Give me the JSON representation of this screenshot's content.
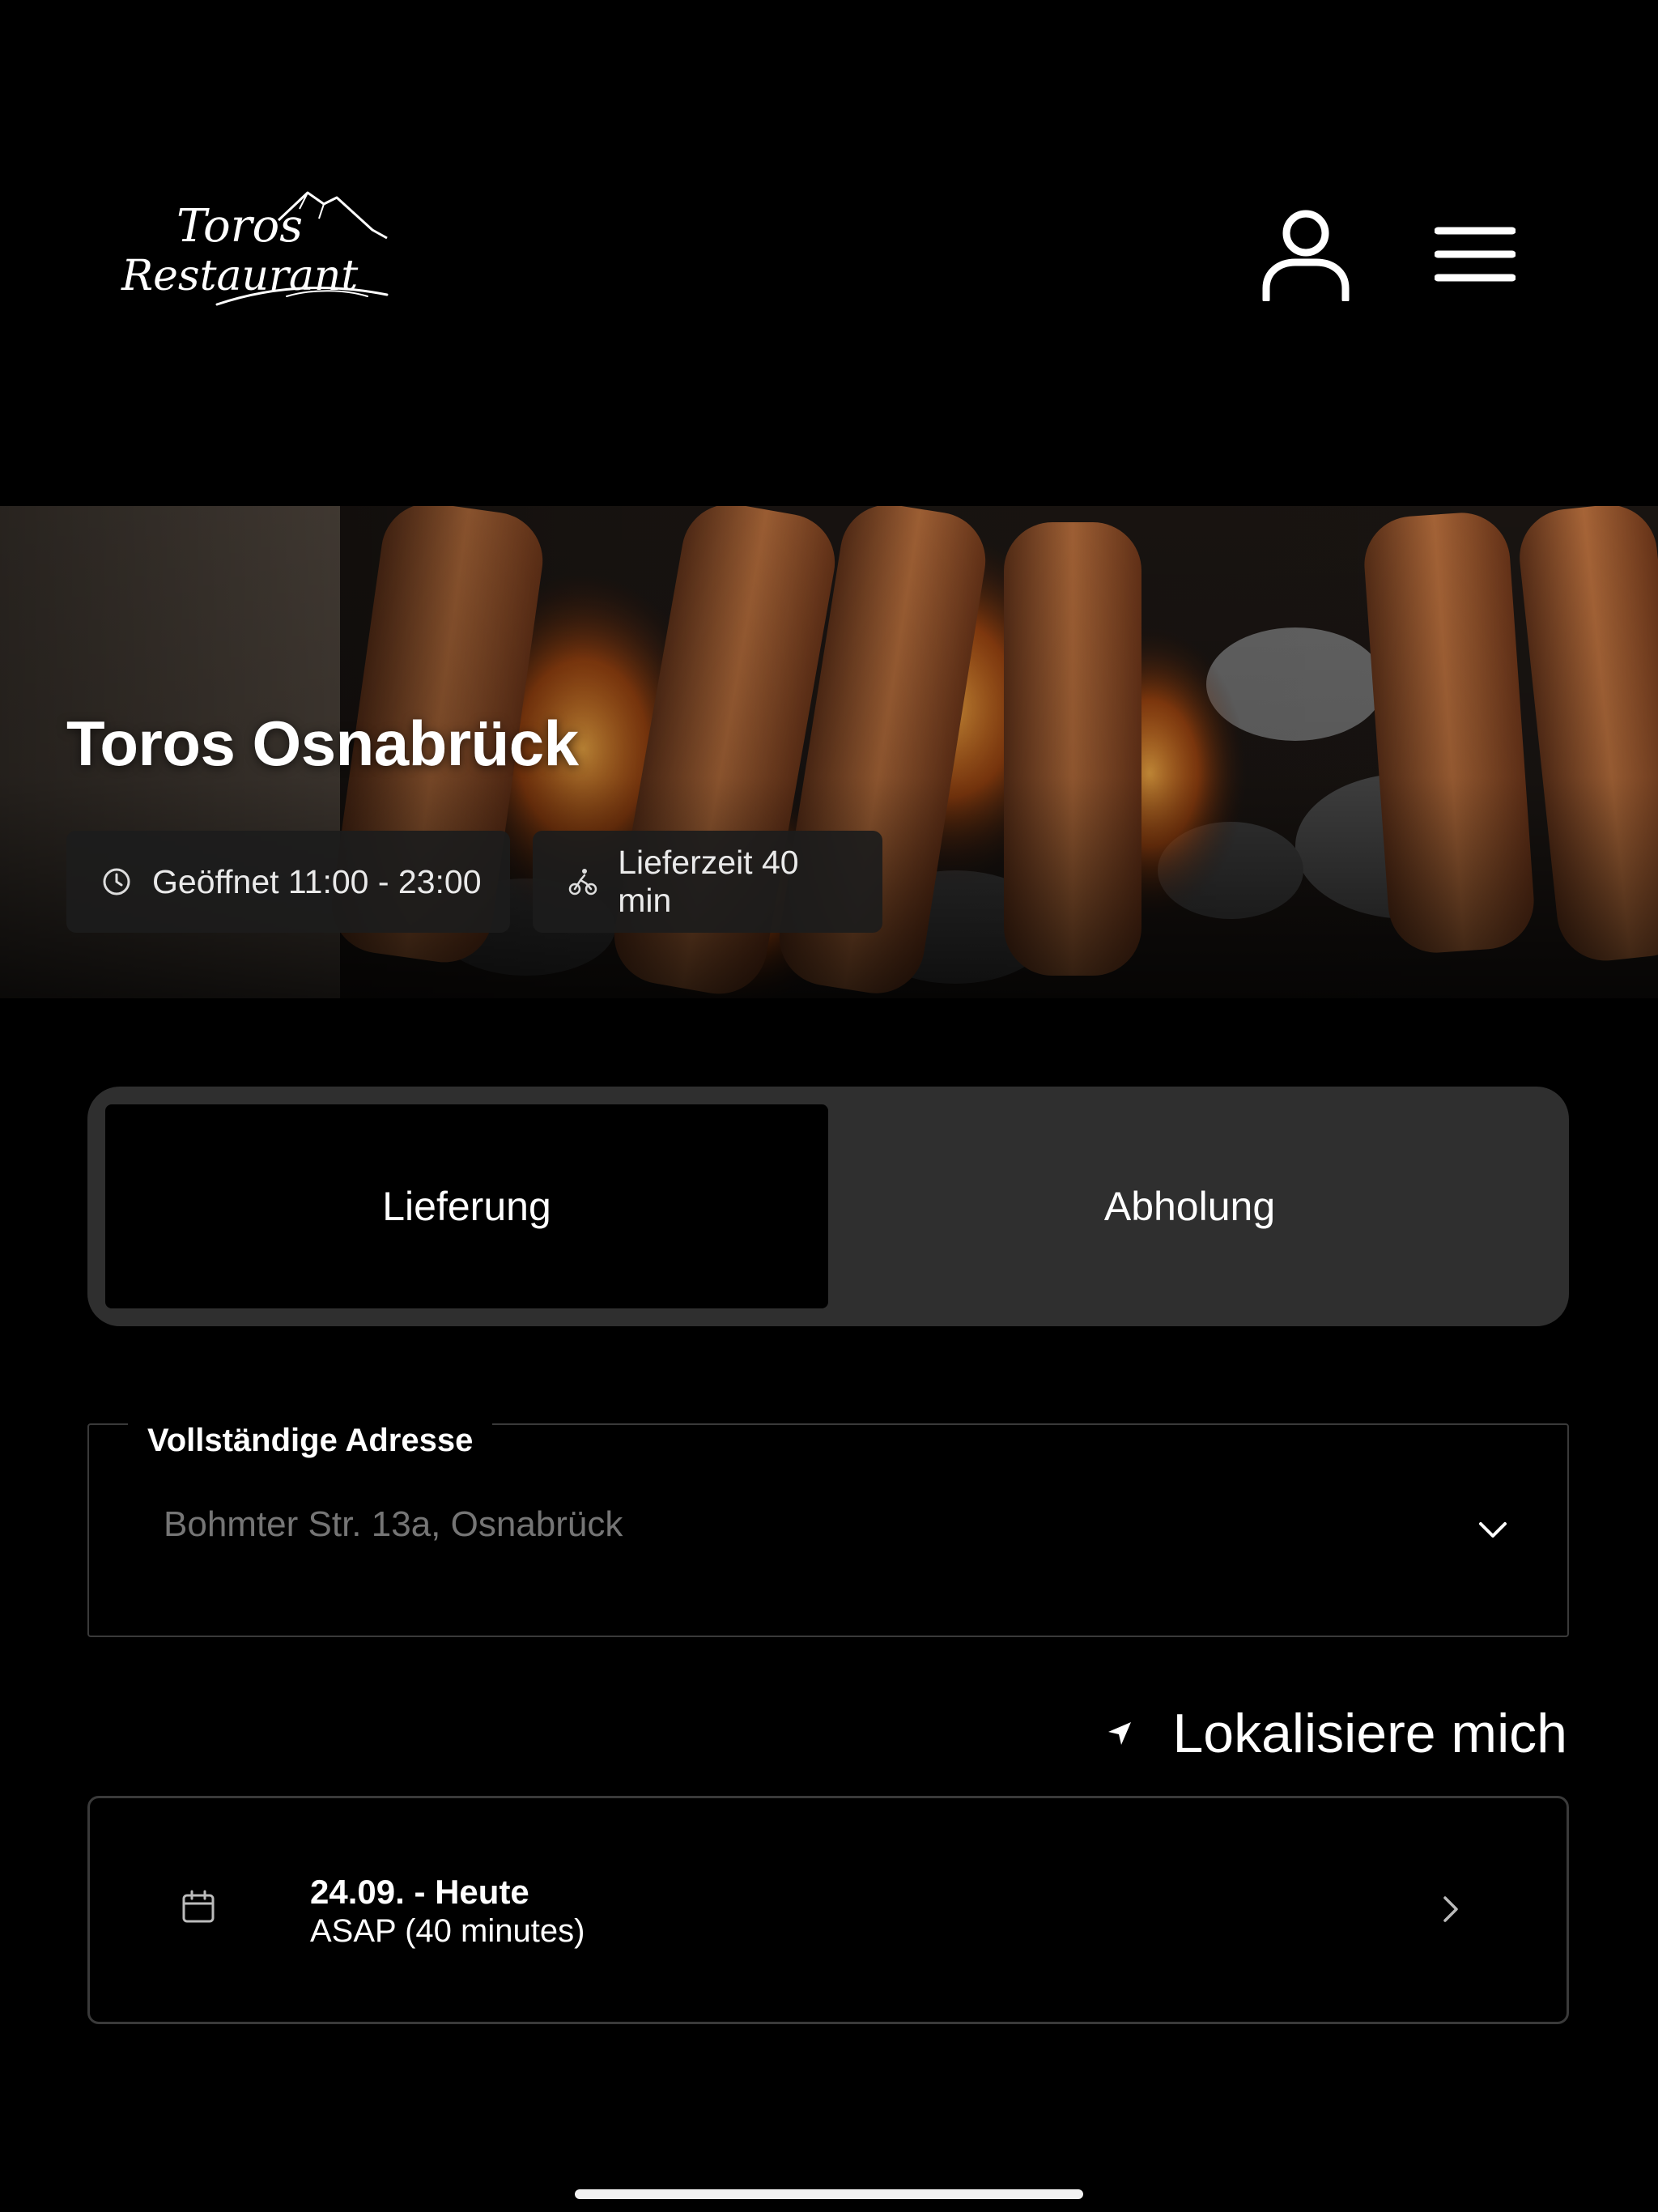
{
  "header": {
    "logo_text_line1": "Toros",
    "logo_text_line2": "Restaurant",
    "icons": {
      "account": "user-icon",
      "menu": "hamburger-menu-icon"
    }
  },
  "hero": {
    "title": "Toros Osnabrück",
    "opening_hours": "Geöffnet 11:00 - 23:00",
    "delivery_time": "Lieferzeit 40 min",
    "icons": {
      "opening_hours": "clock-icon",
      "delivery_time": "bicycle-courier-icon"
    }
  },
  "order_mode": {
    "options": [
      "Lieferung",
      "Abholung"
    ],
    "selected": "Lieferung"
  },
  "address": {
    "label": "Vollständige Adresse",
    "placeholder": "Bohmter Str. 13a, Osnabrück",
    "value": ""
  },
  "locate": {
    "label": "Lokalisiere mich",
    "icon": "location-arrow-icon"
  },
  "schedule": {
    "date": "24.09. - Heute",
    "time": "ASAP (40 minutes)",
    "icons": {
      "calendar": "calendar-icon",
      "arrow": "chevron-right-icon"
    }
  },
  "colors": {
    "background": "#000000",
    "toggle_track": "#2f2f2f",
    "chip_background": "#1c1c1c",
    "border": "#3a3a3a",
    "placeholder": "#8a8a8a"
  }
}
